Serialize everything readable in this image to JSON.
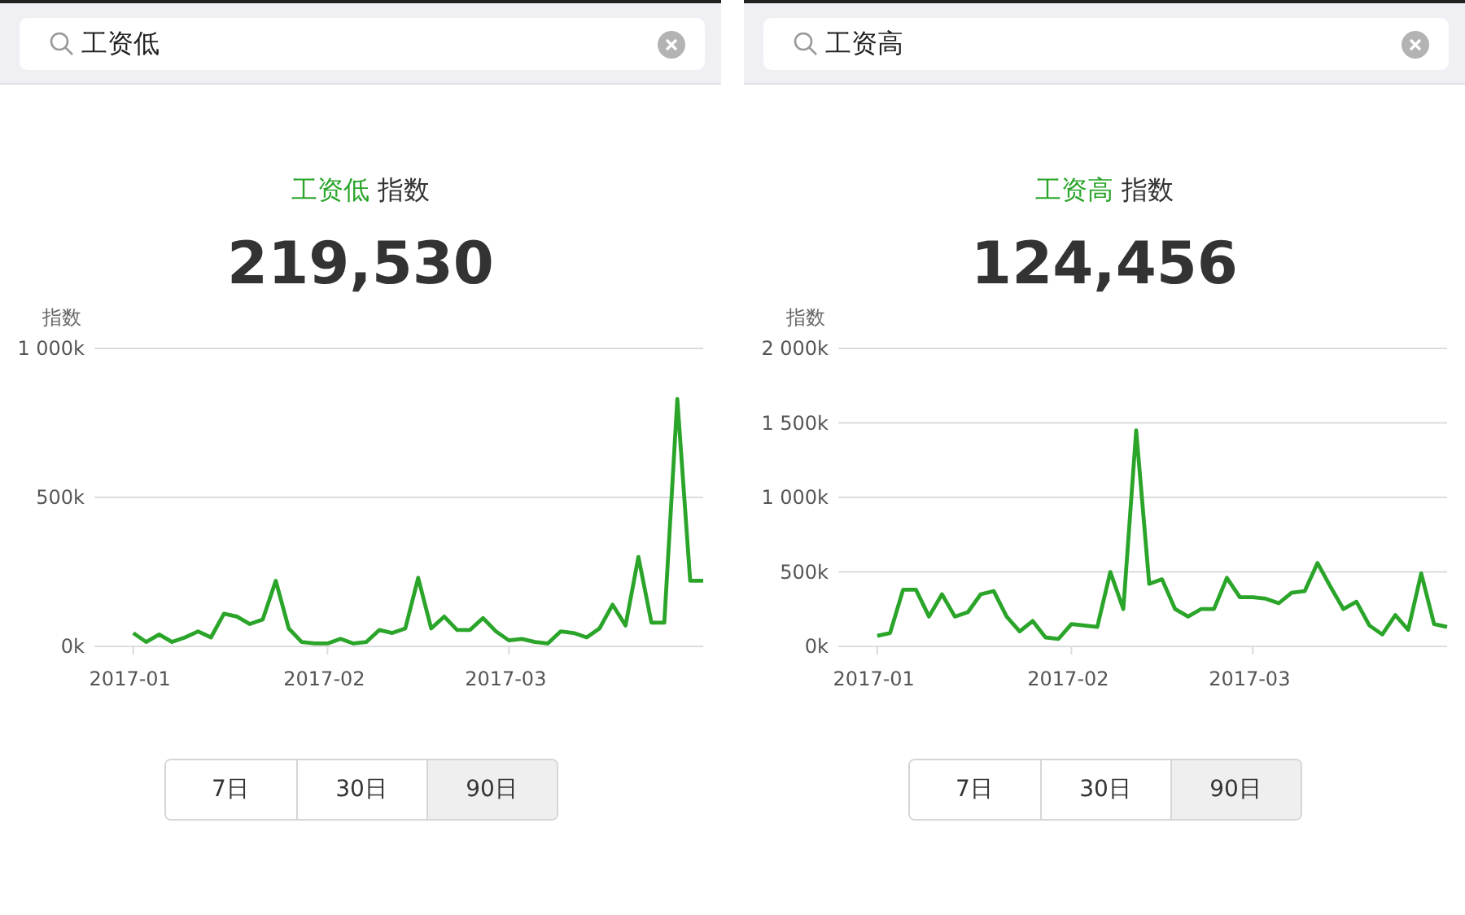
{
  "panels": [
    {
      "search": {
        "value": "工资低"
      },
      "keyword": "工资低",
      "title_suffix": "指数",
      "total": "219,530",
      "chart_data": {
        "type": "line",
        "ylabel": "指数",
        "categories": [
          "2017-01",
          null,
          null,
          null,
          null,
          null,
          null,
          null,
          null,
          null,
          null,
          null,
          null,
          null,
          null,
          "2017-02",
          null,
          null,
          null,
          null,
          null,
          null,
          null,
          null,
          null,
          null,
          null,
          null,
          null,
          "2017-03",
          null,
          null,
          null,
          null,
          null,
          null,
          null,
          null,
          null,
          null,
          null,
          null,
          null,
          null,
          null
        ],
        "series": [
          {
            "color": "#2aa52a",
            "values": [
              45,
              15,
              40,
              15,
              30,
              50,
              30,
              110,
              100,
              75,
              90,
              220,
              60,
              15,
              10,
              10,
              25,
              10,
              15,
              55,
              45,
              60,
              230,
              60,
              100,
              55,
              55,
              95,
              50,
              20,
              25,
              15,
              10,
              50,
              45,
              30,
              60,
              140,
              70,
              300,
              80,
              80,
              830,
              220,
              220
            ]
          }
        ],
        "grid": true,
        "ylim": [
          0,
          1000
        ],
        "yticks": [
          {
            "value": 0,
            "label": "0k"
          },
          {
            "value": 500,
            "label": "500k"
          },
          {
            "value": 1000,
            "label": "1 000k"
          }
        ]
      },
      "ranges": [
        {
          "label": "7日",
          "selected": false
        },
        {
          "label": "30日",
          "selected": false
        },
        {
          "label": "90日",
          "selected": true
        }
      ]
    },
    {
      "search": {
        "value": "工资高"
      },
      "keyword": "工资高",
      "title_suffix": "指数",
      "total": "124,456",
      "chart_data": {
        "type": "line",
        "ylabel": "指数",
        "categories": [
          "2017-01",
          null,
          null,
          null,
          null,
          null,
          null,
          null,
          null,
          null,
          null,
          null,
          null,
          null,
          null,
          "2017-02",
          null,
          null,
          null,
          null,
          null,
          null,
          null,
          null,
          null,
          null,
          null,
          null,
          null,
          "2017-03",
          null,
          null,
          null,
          null,
          null,
          null,
          null,
          null,
          null,
          null,
          null,
          null,
          null,
          null,
          null
        ],
        "series": [
          {
            "color": "#2aa52a",
            "values": [
              70,
              90,
              380,
              380,
              200,
              350,
              200,
              230,
              350,
              370,
              200,
              100,
              170,
              60,
              50,
              150,
              140,
              130,
              500,
              250,
              1450,
              420,
              450,
              250,
              200,
              250,
              250,
              460,
              330,
              330,
              320,
              290,
              360,
              370,
              560,
              400,
              250,
              300,
              140,
              80,
              210,
              110,
              490,
              150,
              130
            ]
          }
        ],
        "grid": true,
        "ylim": [
          0,
          2000
        ],
        "yticks": [
          {
            "value": 0,
            "label": "0k"
          },
          {
            "value": 500,
            "label": "500k"
          },
          {
            "value": 1000,
            "label": "1 000k"
          },
          {
            "value": 1500,
            "label": "1 500k"
          },
          {
            "value": 2000,
            "label": "2 000k"
          }
        ]
      },
      "ranges": [
        {
          "label": "7日",
          "selected": false
        },
        {
          "label": "30日",
          "selected": false
        },
        {
          "label": "90日",
          "selected": true
        }
      ]
    }
  ]
}
